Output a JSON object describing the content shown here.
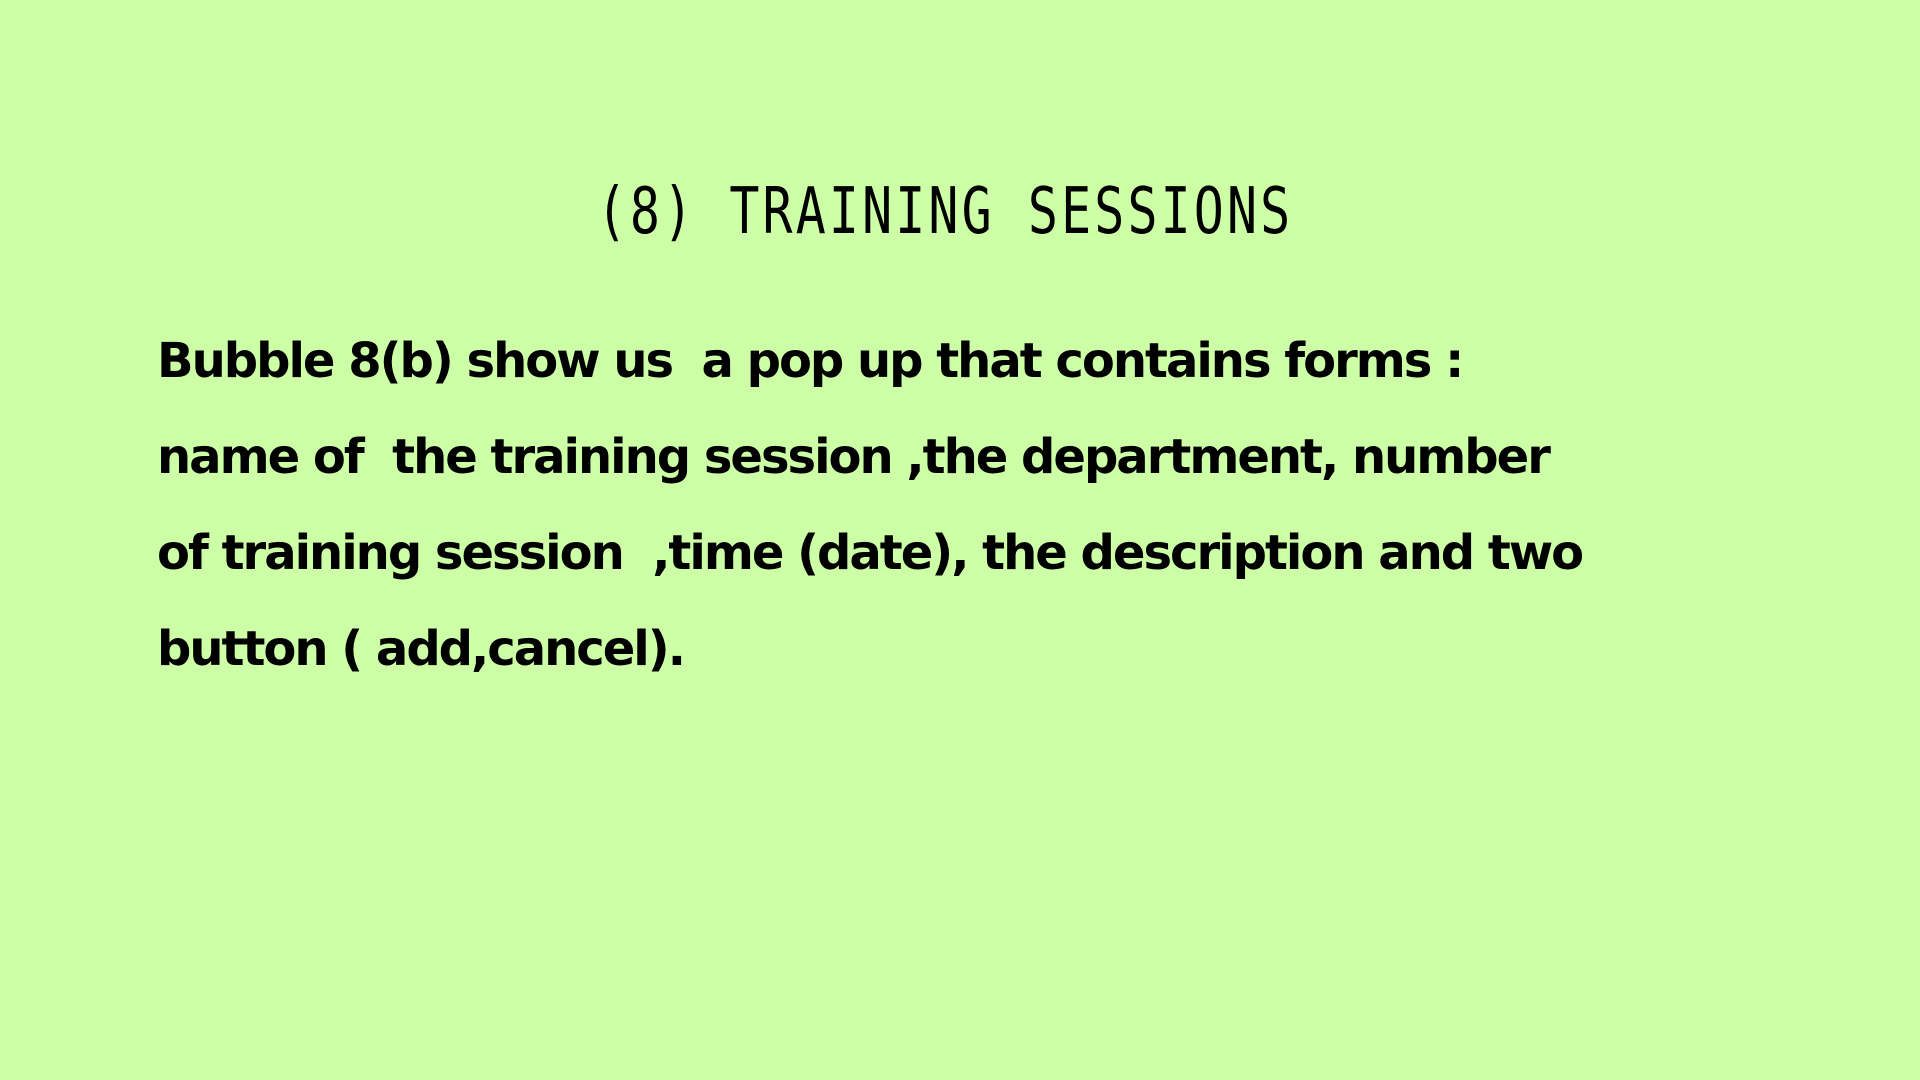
{
  "slide": {
    "title": "(8) TRAINING SESSIONS",
    "body_lines": [
      "Bubble 8(b) show us  a pop up that contains forms :",
      "name of  the training session ,the department, number",
      "of training session  ,time (date), the description and two",
      "button ( add,cancel)."
    ],
    "background_color": "#ccffa6",
    "text_color": "#000000"
  }
}
